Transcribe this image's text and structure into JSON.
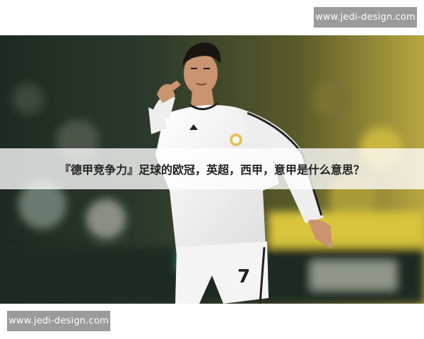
{
  "watermark_top": {
    "text": "www.jedi-design.com"
  },
  "watermark_bottom": {
    "text": "www.jedi-design.com"
  },
  "caption": {
    "text": "『德甲竞争力』足球的欧冠，英超，西甲，意甲是什么意思？"
  },
  "colors": {
    "badge_bg": "#9b9b9b",
    "badge_text": "#ffffff",
    "caption_band": "#ffffff",
    "caption_text": "#222222",
    "kit": "#f2f2f2",
    "stands_yellow": "#d8c53a"
  },
  "photo": {
    "subject": "footballer",
    "kit_number": "7"
  }
}
